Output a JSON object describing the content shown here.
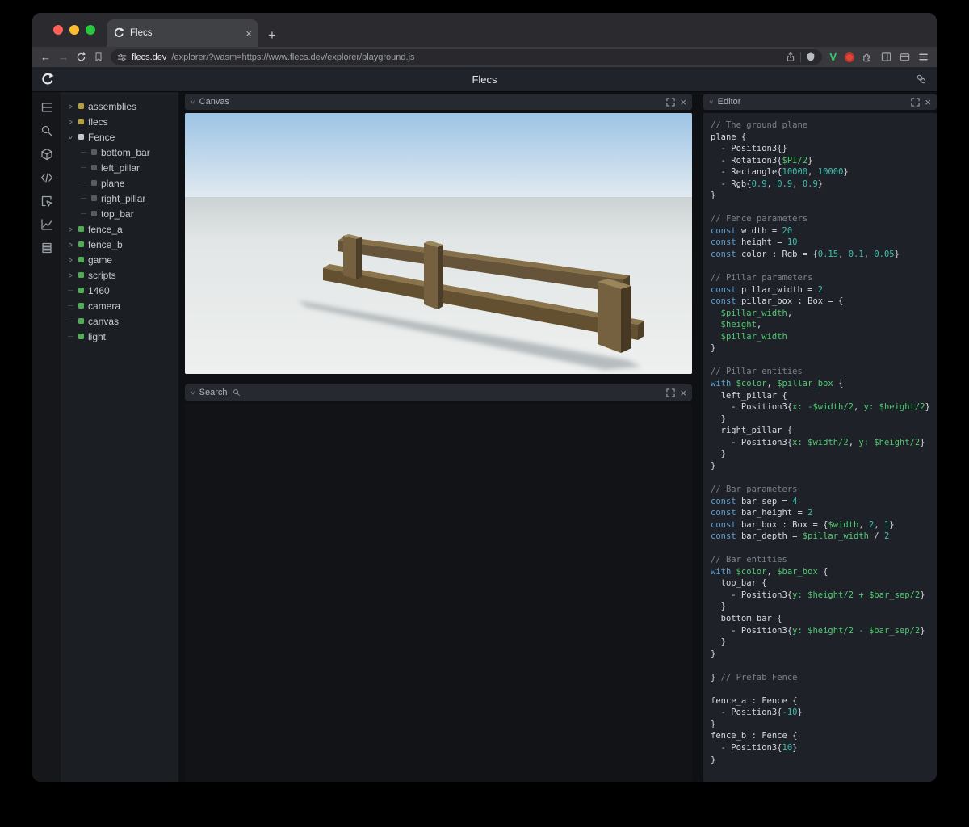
{
  "browser": {
    "tab_title": "Flecs",
    "url_domain": "flecs.dev",
    "url_rest": "/explorer/?wasm=https://www.flecs.dev/explorer/playground.js"
  },
  "header": {
    "title": "Flecs"
  },
  "icons": {
    "close": "×",
    "plus": "+",
    "back": "←",
    "forward": "→",
    "chevron": ">",
    "vlogo": "V"
  },
  "iconbar": {
    "items": [
      "outliner-icon",
      "search-icon",
      "entities-icon",
      "code-icon",
      "inspect-icon",
      "chart-icon",
      "commands-icon"
    ]
  },
  "tree": {
    "items": [
      {
        "label": "assemblies",
        "color": "yellow",
        "arrow": "c",
        "depth": 0
      },
      {
        "label": "flecs",
        "color": "yellow",
        "arrow": "c",
        "depth": 0
      },
      {
        "label": "Fence",
        "color": "light",
        "arrow": "e",
        "depth": 0
      },
      {
        "label": "bottom_bar",
        "color": "dark",
        "arrow": "n",
        "depth": 1
      },
      {
        "label": "left_pillar",
        "color": "dark",
        "arrow": "n",
        "depth": 1
      },
      {
        "label": "plane",
        "color": "dark",
        "arrow": "n",
        "depth": 1
      },
      {
        "label": "right_pillar",
        "color": "dark",
        "arrow": "n",
        "depth": 1
      },
      {
        "label": "top_bar",
        "color": "dark",
        "arrow": "n",
        "depth": 1
      },
      {
        "label": "fence_a",
        "color": "green",
        "arrow": "c",
        "depth": 0
      },
      {
        "label": "fence_b",
        "color": "green",
        "arrow": "c",
        "depth": 0
      },
      {
        "label": "game",
        "color": "green",
        "arrow": "c",
        "depth": 0
      },
      {
        "label": "scripts",
        "color": "green",
        "arrow": "c",
        "depth": 0
      },
      {
        "label": "1460",
        "color": "green",
        "arrow": "n",
        "depth": 0
      },
      {
        "label": "camera",
        "color": "green",
        "arrow": "n",
        "depth": 0
      },
      {
        "label": "canvas",
        "color": "green",
        "arrow": "n",
        "depth": 0
      },
      {
        "label": "light",
        "color": "green",
        "arrow": "n",
        "depth": 0
      }
    ]
  },
  "panels": {
    "canvas": {
      "title": "Canvas"
    },
    "search": {
      "title": "Search"
    },
    "editor": {
      "title": "Editor"
    }
  },
  "colors": {
    "bullets": {
      "yellow": "#b3a03f",
      "green": "#4fae55",
      "light": "#c3c8cd",
      "dark": "#585d63"
    },
    "accent_green": "#2ecc71",
    "code_keyword": "#5ca0d3",
    "code_variable": "#4ecb71",
    "code_number": "#3fbfae",
    "code_comment": "#7b828c"
  },
  "editor": {
    "lines": [
      [
        [
          "tc",
          "// The ground plane"
        ]
      ],
      [
        [
          "tp",
          "plane {"
        ]
      ],
      [
        [
          "tp",
          "  - Position3{}"
        ]
      ],
      [
        [
          "tp",
          "  - Rotation3{"
        ],
        [
          "tv",
          "$PI/2"
        ],
        [
          "tp",
          "}"
        ]
      ],
      [
        [
          "tp",
          "  - Rectangle{"
        ],
        [
          "tn",
          "10000"
        ],
        [
          "tp",
          ", "
        ],
        [
          "tn",
          "10000"
        ],
        [
          "tp",
          "}"
        ]
      ],
      [
        [
          "tp",
          "  - Rgb{"
        ],
        [
          "tn",
          "0.9"
        ],
        [
          "tp",
          ", "
        ],
        [
          "tn",
          "0.9"
        ],
        [
          "tp",
          ", "
        ],
        [
          "tn",
          "0.9"
        ],
        [
          "tp",
          "}"
        ]
      ],
      [
        [
          "tp",
          "}"
        ]
      ],
      [],
      [
        [
          "tc",
          "// Fence parameters"
        ]
      ],
      [
        [
          "tk",
          "const "
        ],
        [
          "tp",
          "width = "
        ],
        [
          "tn",
          "20"
        ]
      ],
      [
        [
          "tk",
          "const "
        ],
        [
          "tp",
          "height = "
        ],
        [
          "tn",
          "10"
        ]
      ],
      [
        [
          "tk",
          "const "
        ],
        [
          "tp",
          "color : Rgb = {"
        ],
        [
          "tn",
          "0.15"
        ],
        [
          "tp",
          ", "
        ],
        [
          "tn",
          "0.1"
        ],
        [
          "tp",
          ", "
        ],
        [
          "tn",
          "0.05"
        ],
        [
          "tp",
          "}"
        ]
      ],
      [],
      [
        [
          "tc",
          "// Pillar parameters"
        ]
      ],
      [
        [
          "tk",
          "const "
        ],
        [
          "tp",
          "pillar_width = "
        ],
        [
          "tn",
          "2"
        ]
      ],
      [
        [
          "tk",
          "const "
        ],
        [
          "tp",
          "pillar_box : Box = {"
        ]
      ],
      [
        [
          "tv",
          "  $pillar_width"
        ],
        [
          "tp",
          ","
        ]
      ],
      [
        [
          "tv",
          "  $height"
        ],
        [
          "tp",
          ","
        ]
      ],
      [
        [
          "tv",
          "  $pillar_width"
        ]
      ],
      [
        [
          "tp",
          "}"
        ]
      ],
      [],
      [
        [
          "tc",
          "// Pillar entities"
        ]
      ],
      [
        [
          "tk",
          "with "
        ],
        [
          "tv",
          "$color"
        ],
        [
          "tp",
          ", "
        ],
        [
          "tv",
          "$pillar_box"
        ],
        [
          "tp",
          " {"
        ]
      ],
      [
        [
          "tp",
          "  left_pillar {"
        ]
      ],
      [
        [
          "tp",
          "    - Position3{"
        ],
        [
          "tv",
          "x: -$width/2"
        ],
        [
          "tp",
          ", "
        ],
        [
          "tv",
          "y: $height/2"
        ],
        [
          "tp",
          "}"
        ]
      ],
      [
        [
          "tp",
          "  }"
        ]
      ],
      [
        [
          "tp",
          "  right_pillar {"
        ]
      ],
      [
        [
          "tp",
          "    - Position3{"
        ],
        [
          "tv",
          "x: $width/2"
        ],
        [
          "tp",
          ", "
        ],
        [
          "tv",
          "y: $height/2"
        ],
        [
          "tp",
          "}"
        ]
      ],
      [
        [
          "tp",
          "  }"
        ]
      ],
      [
        [
          "tp",
          "}"
        ]
      ],
      [],
      [
        [
          "tc",
          "// Bar parameters"
        ]
      ],
      [
        [
          "tk",
          "const "
        ],
        [
          "tp",
          "bar_sep = "
        ],
        [
          "tn",
          "4"
        ]
      ],
      [
        [
          "tk",
          "const "
        ],
        [
          "tp",
          "bar_height = "
        ],
        [
          "tn",
          "2"
        ]
      ],
      [
        [
          "tk",
          "const "
        ],
        [
          "tp",
          "bar_box : Box = {"
        ],
        [
          "tv",
          "$width"
        ],
        [
          "tp",
          ", "
        ],
        [
          "tn",
          "2"
        ],
        [
          "tp",
          ", "
        ],
        [
          "tn",
          "1"
        ],
        [
          "tp",
          "}"
        ]
      ],
      [
        [
          "tk",
          "const "
        ],
        [
          "tp",
          "bar_depth = "
        ],
        [
          "tv",
          "$pillar_width"
        ],
        [
          "tp",
          " / "
        ],
        [
          "tn",
          "2"
        ]
      ],
      [],
      [
        [
          "tc",
          "// Bar entities"
        ]
      ],
      [
        [
          "tk",
          "with "
        ],
        [
          "tv",
          "$color"
        ],
        [
          "tp",
          ", "
        ],
        [
          "tv",
          "$bar_box"
        ],
        [
          "tp",
          " {"
        ]
      ],
      [
        [
          "tp",
          "  top_bar {"
        ]
      ],
      [
        [
          "tp",
          "    - Position3{"
        ],
        [
          "tv",
          "y: $height/2 + $bar_sep/2"
        ],
        [
          "tp",
          "}"
        ]
      ],
      [
        [
          "tp",
          "  }"
        ]
      ],
      [
        [
          "tp",
          "  bottom_bar {"
        ]
      ],
      [
        [
          "tp",
          "    - Position3{"
        ],
        [
          "tv",
          "y: $height/2 - $bar_sep/2"
        ],
        [
          "tp",
          "}"
        ]
      ],
      [
        [
          "tp",
          "  }"
        ]
      ],
      [
        [
          "tp",
          "}"
        ]
      ],
      [],
      [
        [
          "tp",
          "} "
        ],
        [
          "tc",
          "// Prefab Fence"
        ]
      ],
      [],
      [
        [
          "tp",
          "fence_a : Fence {"
        ]
      ],
      [
        [
          "tp",
          "  - Position3{"
        ],
        [
          "tn",
          "-10"
        ],
        [
          "tp",
          "}"
        ]
      ],
      [
        [
          "tp",
          "}"
        ]
      ],
      [
        [
          "tp",
          "fence_b : Fence {"
        ]
      ],
      [
        [
          "tp",
          "  - Position3{"
        ],
        [
          "tn",
          "10"
        ],
        [
          "tp",
          "}"
        ]
      ],
      [
        [
          "tp",
          "}"
        ]
      ]
    ]
  }
}
